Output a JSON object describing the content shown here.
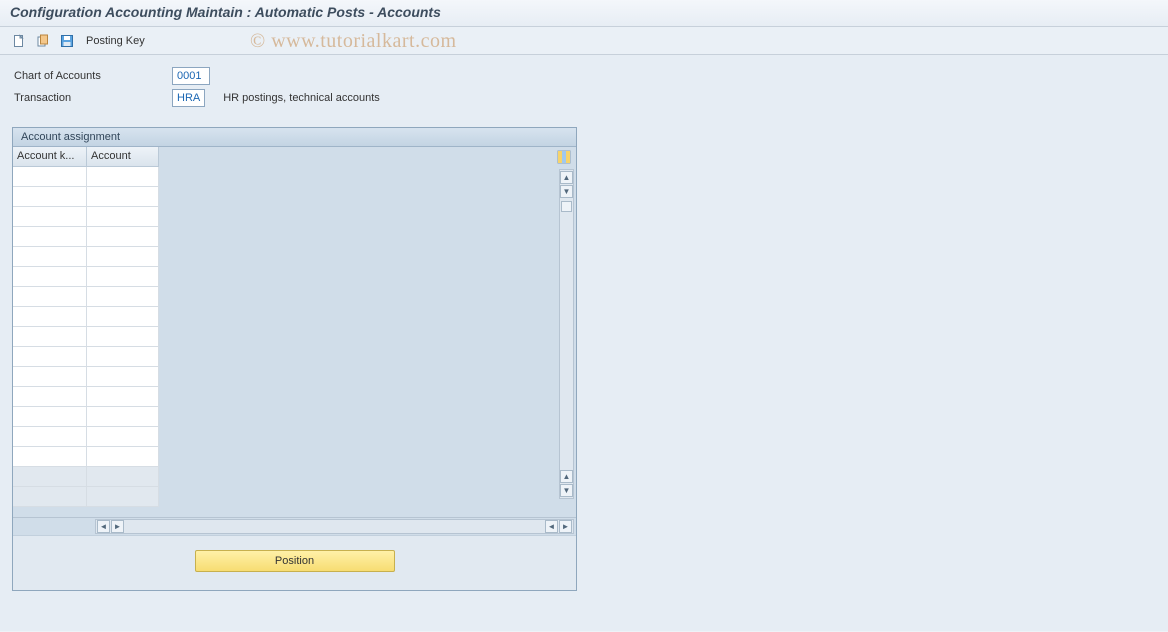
{
  "title": "Configuration Accounting Maintain : Automatic Posts - Accounts",
  "toolbar": {
    "posting_key_label": "Posting Key",
    "icon1": "new-document-icon",
    "icon2": "copy-icon",
    "icon3": "save-icon"
  },
  "fields": {
    "chart_label": "Chart of Accounts",
    "chart_value": "0001",
    "transaction_label": "Transaction",
    "transaction_value": "HRA",
    "transaction_desc": "HR postings, technical accounts"
  },
  "panel": {
    "header": "Account assignment",
    "columns": [
      "Account k...",
      "Account"
    ],
    "position_button": "Position",
    "config_icon": "table-settings-icon"
  },
  "watermark": "© www.tutorialkart.com"
}
